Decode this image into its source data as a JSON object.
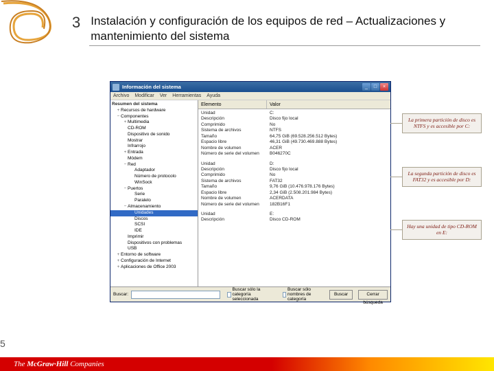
{
  "slide": {
    "number": "3",
    "title": "Instalación y configuración de los equipos de red – Actualizaciones y mantenimiento del sistema"
  },
  "window": {
    "title": "Información del sistema",
    "menu": [
      "Archivo",
      "Modificar",
      "Ver",
      "Herramientas",
      "Ayuda"
    ],
    "tree_root": "Resumen del sistema",
    "tree": [
      {
        "txt": "Recursos de hardware",
        "lvl": 1,
        "tw": "+"
      },
      {
        "txt": "Componentes",
        "lvl": 1,
        "tw": "−"
      },
      {
        "txt": "Multimedia",
        "lvl": 2,
        "tw": "+"
      },
      {
        "txt": "CD-ROM",
        "lvl": 2,
        "tw": ""
      },
      {
        "txt": "Dispositivo de sonido",
        "lvl": 2,
        "tw": ""
      },
      {
        "txt": "Mostrar",
        "lvl": 2,
        "tw": ""
      },
      {
        "txt": "Infrarrojo",
        "lvl": 2,
        "tw": ""
      },
      {
        "txt": "Entrada",
        "lvl": 2,
        "tw": "+"
      },
      {
        "txt": "Módem",
        "lvl": 2,
        "tw": ""
      },
      {
        "txt": "Red",
        "lvl": 2,
        "tw": "−"
      },
      {
        "txt": "Adaptador",
        "lvl": 3,
        "tw": ""
      },
      {
        "txt": "Número de protocolo",
        "lvl": 3,
        "tw": ""
      },
      {
        "txt": "WinSock",
        "lvl": 3,
        "tw": ""
      },
      {
        "txt": "Puertos",
        "lvl": 2,
        "tw": "−"
      },
      {
        "txt": "Serie",
        "lvl": 3,
        "tw": ""
      },
      {
        "txt": "Paralelo",
        "lvl": 3,
        "tw": ""
      },
      {
        "txt": "Almacenamiento",
        "lvl": 2,
        "tw": "−"
      },
      {
        "txt": "Unidades",
        "lvl": 3,
        "tw": "",
        "sel": true
      },
      {
        "txt": "Discos",
        "lvl": 3,
        "tw": ""
      },
      {
        "txt": "SCSI",
        "lvl": 3,
        "tw": ""
      },
      {
        "txt": "IDE",
        "lvl": 3,
        "tw": ""
      },
      {
        "txt": "Imprimir",
        "lvl": 2,
        "tw": ""
      },
      {
        "txt": "Dispositivos con problemas",
        "lvl": 2,
        "tw": ""
      },
      {
        "txt": "USB",
        "lvl": 2,
        "tw": ""
      },
      {
        "txt": "Entorno de software",
        "lvl": 1,
        "tw": "+"
      },
      {
        "txt": "Configuración de Internet",
        "lvl": 1,
        "tw": "+"
      },
      {
        "txt": "Aplicaciones de Office 2003",
        "lvl": 1,
        "tw": "+"
      }
    ],
    "columns": {
      "c1": "Elemento",
      "c2": "Valor"
    },
    "rows": [
      {
        "k": "Unidad",
        "v": "C:"
      },
      {
        "k": "Descripción",
        "v": "Disco fijo local"
      },
      {
        "k": "Comprimido",
        "v": "No"
      },
      {
        "k": "Sistema de archivos",
        "v": "NTFS"
      },
      {
        "k": "Tamaño",
        "v": "64,75 GiB (69.528.256.512 Bytes)"
      },
      {
        "k": "Espacio libre",
        "v": "46,31 GiB (49.730.469.888 Bytes)"
      },
      {
        "k": "Nombre de volumen",
        "v": "ACER"
      },
      {
        "k": "Número de serie del volumen",
        "v": "B046270C"
      },
      {
        "sep": true
      },
      {
        "k": "Unidad",
        "v": "D:"
      },
      {
        "k": "Descripción",
        "v": "Disco fijo local"
      },
      {
        "k": "Comprimido",
        "v": "No"
      },
      {
        "k": "Sistema de archivos",
        "v": "FAT32"
      },
      {
        "k": "Tamaño",
        "v": "9,76 GiB (10.476.978.176 Bytes)"
      },
      {
        "k": "Espacio libre",
        "v": "2,34 GiB (2.508.201.984 Bytes)"
      },
      {
        "k": "Nombre de volumen",
        "v": "ACERDATA"
      },
      {
        "k": "Número de serie del volumen",
        "v": "182B16F1"
      },
      {
        "sep": true
      },
      {
        "k": "Unidad",
        "v": "E:"
      },
      {
        "k": "Descripción",
        "v": "Disco CD-ROM"
      }
    ],
    "search": {
      "label": "Buscar:",
      "opt1": "Buscar sólo la categoría seleccionada",
      "opt2": "Buscar sólo nombres de categoría",
      "btn_search": "Buscar",
      "btn_clear": "Cerrar búsqueda"
    }
  },
  "callouts": {
    "c1": "La primera partición de disco es NTFS y es accesible por C:",
    "c2": "La segunda partición de disco es FAT32 y es accesible por D:",
    "c3": "Hay una unidad de tipo CD-ROM en E:"
  },
  "pagecut": "5",
  "footer": {
    "brand_prefix": "The ",
    "brand_bold": "McGraw·Hill",
    "brand_suffix": " Companies"
  }
}
